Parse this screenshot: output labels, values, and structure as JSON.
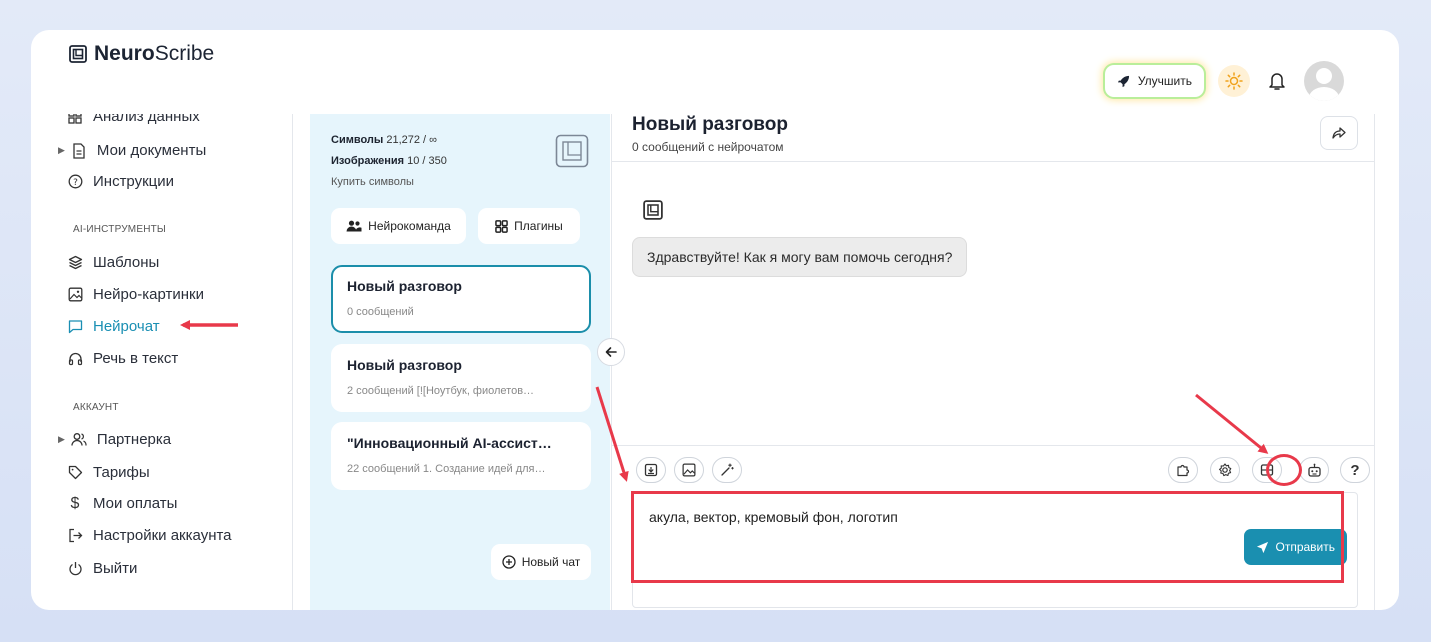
{
  "header": {
    "brand_bold": "Neuro",
    "brand_rest": "Scribe",
    "upgrade_label": "Улучшить",
    "icons": [
      "logo-icon",
      "rocket-icon",
      "sun-icon",
      "bell-icon",
      "avatar"
    ]
  },
  "sidebar": {
    "items_top": [
      {
        "label": "Анализ данных",
        "icon": "grid-icon"
      },
      {
        "label": "Мои документы",
        "icon": "document-icon"
      },
      {
        "label": "Инструкции",
        "icon": "help-circle-icon"
      }
    ],
    "section_ai": "AI-ИНСТРУМЕНТЫ",
    "items_ai": [
      {
        "label": "Шаблоны",
        "icon": "layers-icon"
      },
      {
        "label": "Нейро-картинки",
        "icon": "image-icon"
      },
      {
        "label": "Нейрочат",
        "icon": "chat-icon"
      },
      {
        "label": "Речь в текст",
        "icon": "headphones-icon"
      }
    ],
    "section_account": "АККАУНТ",
    "items_account": [
      {
        "label": "Партнерка",
        "icon": "users-icon"
      },
      {
        "label": "Тарифы",
        "icon": "tag-icon"
      },
      {
        "label": "Мои оплаты",
        "icon": "dollar-icon"
      },
      {
        "label": "Настройки аккаунта",
        "icon": "login-icon"
      },
      {
        "label": "Выйти",
        "icon": "power-icon"
      }
    ]
  },
  "credits": {
    "symbols_label": "Символы",
    "symbols_value": " 21,272 / ∞",
    "images_label": "Изображения",
    "images_value": " 10 / 350",
    "buy_label": "Купить символы"
  },
  "chatlist": {
    "team_button": "Нейрокоманда",
    "plugins_button": "Плагины",
    "chats": [
      {
        "title": "Новый разговор",
        "subtitle": "0 сообщений"
      },
      {
        "title": "Новый разговор",
        "subtitle": "2 сообщений    [![Ноутбук, фиолетов…"
      },
      {
        "title": "\"Инновационный AI-ассист…",
        "subtitle": "22 сообщений  1. Создание идей для…"
      }
    ],
    "new_chat_button": "Новый чат"
  },
  "chat": {
    "title": "Новый разговор",
    "subtitle": "0 сообщений с нейрочатом",
    "greeting": "Здравствуйте! Как я могу вам помочь сегодня?",
    "input_value": "акула, вектор, кремовый фон, логотип",
    "send_label": "Отправить",
    "help_label": "?"
  },
  "colors": {
    "accent": "#1a8fb0",
    "panel_bg": "#e6f5fc",
    "annotation_red": "#e8394a"
  }
}
